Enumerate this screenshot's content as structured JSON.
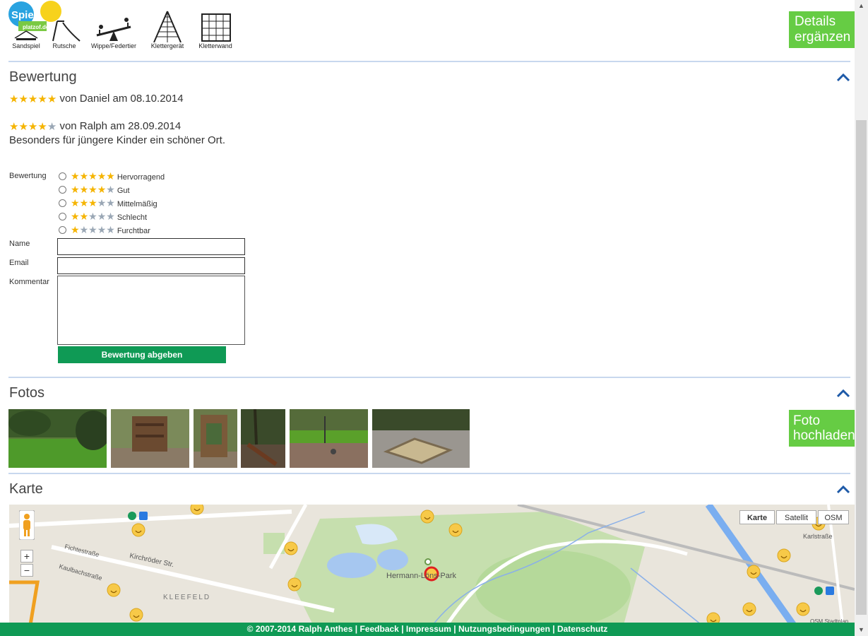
{
  "logo": {
    "text_top": "Spiel",
    "text_bottom": "platzof.de"
  },
  "equipment": [
    {
      "label": "Sandspiel",
      "icon": "sandbox-icon"
    },
    {
      "label": "Rutsche",
      "icon": "slide-icon"
    },
    {
      "label": "Wippe/Federtier",
      "icon": "seesaw-icon"
    },
    {
      "label": "Klettergerät",
      "icon": "climbing-frame-icon"
    },
    {
      "label": "Kletterwand",
      "icon": "climbing-wall-icon"
    }
  ],
  "details_button": {
    "line1": "Details",
    "line2": "ergänzen"
  },
  "rating_section": {
    "title": "Bewertung",
    "reviews": [
      {
        "stars": 5,
        "text": "von Daniel am 08.10.2014",
        "comment": ""
      },
      {
        "stars": 4,
        "text": "von Ralph am 28.09.2014",
        "comment": "Besonders für jüngere Kinder ein schöner Ort."
      }
    ],
    "form": {
      "rating_label": "Bewertung",
      "options": [
        {
          "stars": 5,
          "label": "Hervorragend"
        },
        {
          "stars": 4,
          "label": "Gut"
        },
        {
          "stars": 3,
          "label": "Mittelmäßig"
        },
        {
          "stars": 2,
          "label": "Schlecht"
        },
        {
          "stars": 1,
          "label": "Furchtbar"
        }
      ],
      "name_label": "Name",
      "email_label": "Email",
      "comment_label": "Kommentar",
      "submit_label": "Bewertung abgeben"
    }
  },
  "photos_section": {
    "title": "Fotos",
    "upload_button": {
      "line1": "Foto",
      "line2": "hochladen"
    },
    "photo_count": 6
  },
  "map_section": {
    "title": "Karte",
    "map_types": [
      "Karte",
      "Satellit",
      "OSM"
    ],
    "selected_type": "Karte",
    "labels": {
      "park": "Hermann-Löns-Park",
      "kirchroeder": "Kirchröder Str.",
      "fichte": "Fichtestraße",
      "kaulbach": "Kaulbachstraße",
      "kleefeld": "KLEEFELD",
      "karlstrasse": "Karlstraße",
      "osm": "OSM Stadtplan"
    },
    "zoom_in": "+",
    "zoom_out": "−"
  },
  "footer": {
    "copyright": "© 2007-2014 Ralph Anthes",
    "links": [
      "Feedback",
      "Impressum",
      "Nutzungsbedingungen",
      "Datenschutz"
    ],
    "separator": " | "
  },
  "colors": {
    "accent_green": "#66cc44",
    "dark_green": "#0f9a55",
    "star_on": "#f5b400",
    "star_off": "#9aa7b5",
    "divider": "#c8d8ee"
  }
}
